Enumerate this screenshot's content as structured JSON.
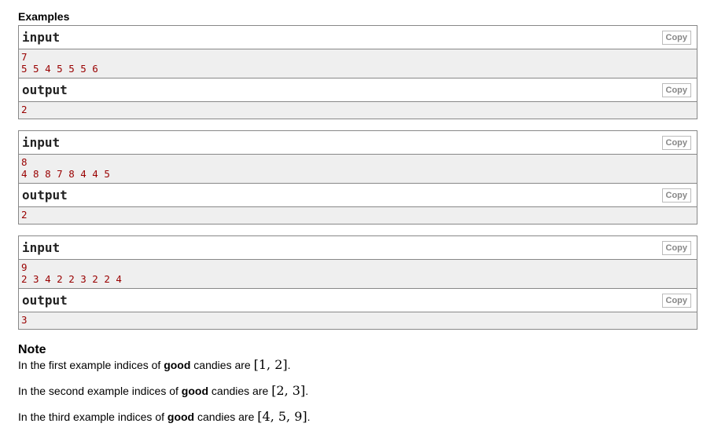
{
  "examples_title": "Examples",
  "copy_label": "Copy",
  "examples": [
    {
      "input_label": "input",
      "input_lines": [
        "7",
        "5 5 4 5 5 5 6"
      ],
      "output_label": "output",
      "output_lines": [
        "2"
      ]
    },
    {
      "input_label": "input",
      "input_lines": [
        "8",
        "4 8 8 7 8 4 4 5"
      ],
      "output_label": "output",
      "output_lines": [
        "2"
      ]
    },
    {
      "input_label": "input",
      "input_lines": [
        "9",
        "2 3 4 2 2 3 2 2 4"
      ],
      "output_label": "output",
      "output_lines": [
        "3"
      ]
    }
  ],
  "note": {
    "title": "Note",
    "lines": [
      {
        "prefix": "In the first example indices of ",
        "bold": "good",
        "suffix": " candies are ",
        "math": "[1, 2]",
        "end": "."
      },
      {
        "prefix": "In the second example indices of ",
        "bold": "good",
        "suffix": " candies are ",
        "math": "[2, 3]",
        "end": "."
      },
      {
        "prefix": "In the third example indices of ",
        "bold": "good",
        "suffix": " candies are ",
        "math": "[4, 5, 9]",
        "end": "."
      }
    ]
  }
}
